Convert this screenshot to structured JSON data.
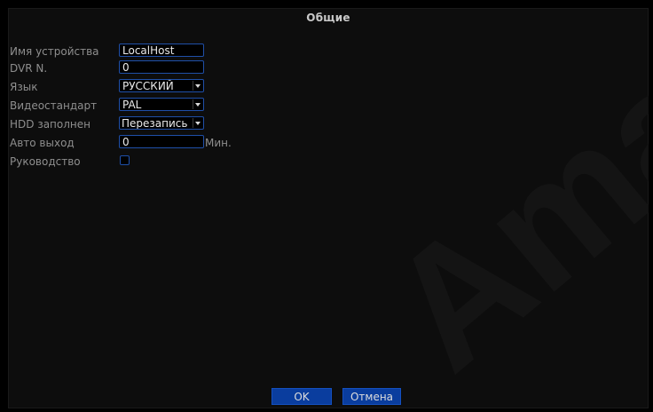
{
  "dialog": {
    "title": "Общие",
    "fields": {
      "device_name": {
        "label": "Имя устройства",
        "value": "LocalHost"
      },
      "dvr_no": {
        "label": "DVR N.",
        "value": "0"
      },
      "language": {
        "label": "Язык",
        "value": "РУССКИЙ"
      },
      "video_standard": {
        "label": "Видеостандарт",
        "value": "PAL"
      },
      "hdd_full": {
        "label": "HDD заполнен",
        "value": "Перезапись"
      },
      "auto_logout": {
        "label": "Авто выход",
        "value": "0",
        "unit": "Мин."
      },
      "guide": {
        "label": "Руководство",
        "checked": false
      }
    },
    "buttons": {
      "ok": "OK",
      "cancel": "Отмена"
    }
  }
}
